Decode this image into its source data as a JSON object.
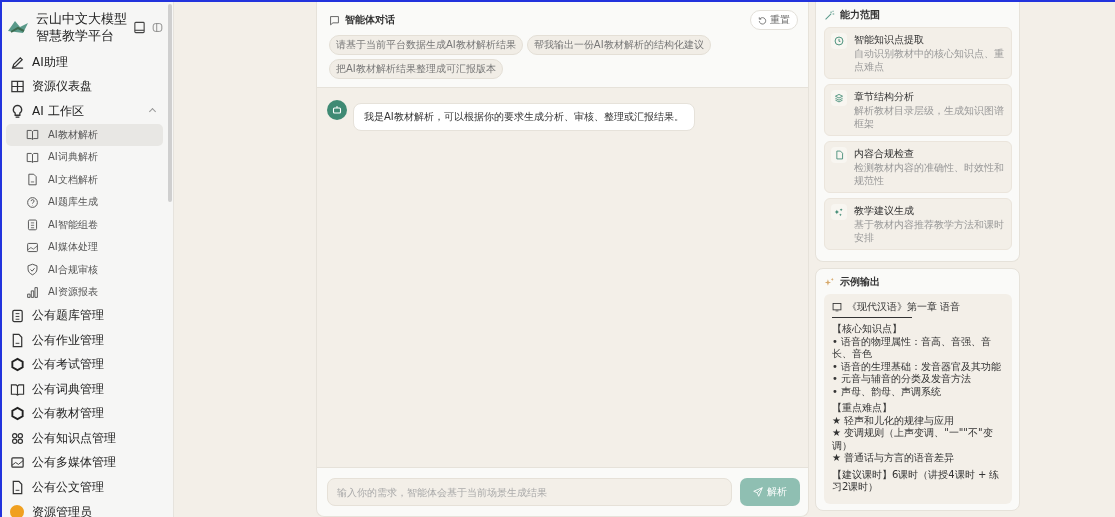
{
  "brand": {
    "line1": "云山中文大模型",
    "line2": "智慧教学平台"
  },
  "nav": [
    {
      "label": "AI助理",
      "selected": false
    },
    {
      "label": "资源仪表盘",
      "selected": false
    },
    {
      "label": "AI 工作区",
      "expanded": true,
      "children": [
        {
          "label": "AI教材解析",
          "selected": true
        },
        {
          "label": "AI词典解析",
          "selected": false
        },
        {
          "label": "AI文档解析",
          "selected": false
        },
        {
          "label": "AI题库生成",
          "selected": false
        },
        {
          "label": "AI智能组卷",
          "selected": false
        },
        {
          "label": "AI媒体处理",
          "selected": false
        },
        {
          "label": "AI合规审核",
          "selected": false
        },
        {
          "label": "AI资源报表",
          "selected": false
        }
      ]
    },
    {
      "label": "公有题库管理",
      "selected": false
    },
    {
      "label": "公有作业管理",
      "selected": false
    },
    {
      "label": "公有考试管理",
      "selected": false
    },
    {
      "label": "公有词典管理",
      "selected": false
    },
    {
      "label": "公有教材管理",
      "selected": false
    },
    {
      "label": "公有知识点管理",
      "selected": false
    },
    {
      "label": "公有多媒体管理",
      "selected": false
    },
    {
      "label": "公有公文管理",
      "selected": false
    }
  ],
  "user": {
    "name": "资源管理员"
  },
  "chat": {
    "title": "智能体对话",
    "reset": "重置",
    "suggestions": [
      "请基于当前平台数据生成AI教材解析结果",
      "帮我输出一份AI教材解析的结构化建议",
      "把AI教材解析结果整理成可汇报版本"
    ],
    "messages": [
      {
        "text": "我是AI教材解析，可以根据你的要求生成分析、审核、整理或汇报结果。"
      }
    ],
    "input": {
      "placeholder": "输入你的需求，智能体会基于当前场景生成结果"
    },
    "send": "解析"
  },
  "capabilities": {
    "title": "能力范围",
    "items": [
      {
        "title": "智能知识点提取",
        "desc": "自动识别教材中的核心知识点、重点难点"
      },
      {
        "title": "章节结构分析",
        "desc": "解析教材目录层级，生成知识图谱框架"
      },
      {
        "title": "内容合规检查",
        "desc": "检测教材内容的准确性、时效性和规范性"
      },
      {
        "title": "教学建议生成",
        "desc": "基于教材内容推荐教学方法和课时安排"
      }
    ]
  },
  "example": {
    "title": "示例输出",
    "doc_title": "《现代汉语》第一章 语音",
    "sections": [
      {
        "heading": "【核心知识点】",
        "lines": [
          "• 语音的物理属性：音高、音强、音长、音色",
          "• 语音的生理基础：发音器官及其功能",
          "• 元音与辅音的分类及发音方法",
          "• 声母、韵母、声调系统"
        ]
      },
      {
        "heading": "【重点难点】",
        "lines": [
          "★ 轻声和儿化的规律与应用",
          "★ 变调规则（上声变调、\"一\"\"不\"变调）",
          "★ 普通话与方言的语音差异"
        ]
      }
    ],
    "footer_label": "【建议课时】",
    "footer_text": "6课时（讲授4课时 + 练习2课时）"
  }
}
